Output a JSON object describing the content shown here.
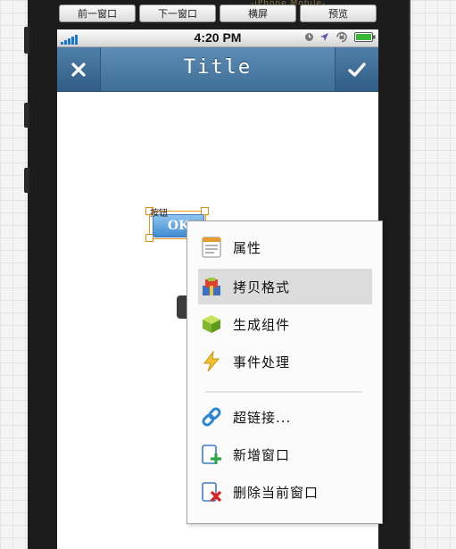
{
  "toolbar": {
    "caption": "-iPhone Mobile-",
    "buttons": [
      "前一窗口",
      "下一窗口",
      "横屏",
      "预览"
    ]
  },
  "statusbar": {
    "time": "4:20 PM"
  },
  "navbar": {
    "title": "Title",
    "left_icon": "close-icon",
    "right_icon": "check-icon"
  },
  "canvas": {
    "widget_label": "按钮",
    "button_text": "OK"
  },
  "context_menu": {
    "items": [
      {
        "label": "属性",
        "icon": "properties-icon"
      },
      {
        "label": "拷贝格式",
        "icon": "copy-format-icon",
        "highlighted": true
      },
      {
        "label": "生成组件",
        "icon": "generate-component-icon"
      },
      {
        "label": "事件处理",
        "icon": "event-handler-icon"
      },
      {
        "label": "超链接...",
        "icon": "hyperlink-icon"
      },
      {
        "label": "新增窗口",
        "icon": "add-window-icon"
      },
      {
        "label": "删除当前窗口",
        "icon": "delete-window-icon"
      }
    ]
  },
  "colors": {
    "navbar": "#4a7aa5",
    "selection": "#e39a16",
    "button": "#4f97d8"
  }
}
